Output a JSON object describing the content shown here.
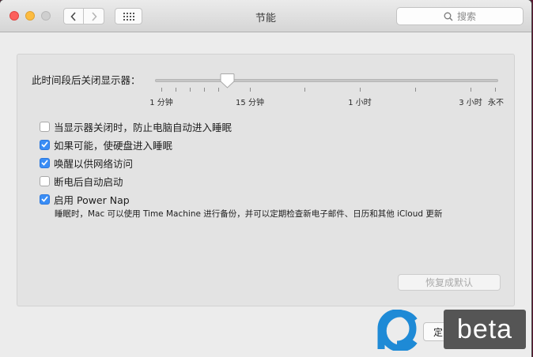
{
  "window": {
    "title": "节能"
  },
  "search": {
    "placeholder": "搜索"
  },
  "slider": {
    "label": "此时间段后关闭显示器：",
    "value_label": "15 分钟",
    "ticks": [
      "1 分钟",
      "15 分钟",
      "1 小时",
      "3 小时",
      "永不"
    ]
  },
  "options": [
    {
      "label": "当显示器关闭时，防止电脑自动进入睡眠",
      "checked": false
    },
    {
      "label": "如果可能，使硬盘进入睡眠",
      "checked": true
    },
    {
      "label": "唤醒以供网络访问",
      "checked": true
    },
    {
      "label": "断电后自动启动",
      "checked": false
    },
    {
      "label": "启用 Power Nap",
      "checked": true
    }
  ],
  "power_nap_description": "睡眠时，Mac 可以使用 Time Machine 进行备份，并可以定期检查新电子邮件、日历和其他 iCloud 更新",
  "buttons": {
    "restore_defaults": "恢复成默认",
    "ok": "定"
  },
  "watermark": {
    "text": "beta",
    "brand_color": "#1e8ad6"
  },
  "colors": {
    "checkbox_accent": "#3a8df5"
  }
}
